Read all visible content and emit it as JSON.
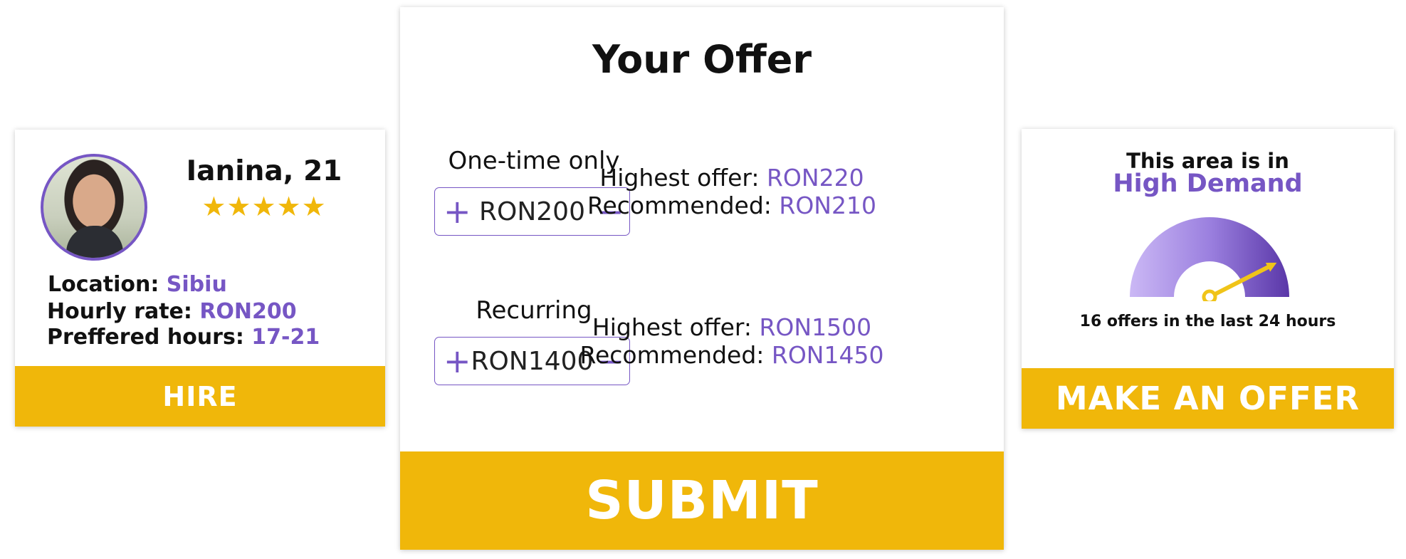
{
  "profile": {
    "name": "Ianina, 21",
    "stars": "★★★★★",
    "rating": 4.5,
    "location_label": "Location: ",
    "location_value": "Sibiu",
    "rate_label": "Hourly rate: ",
    "rate_value": "RON200",
    "hours_label": "Preffered hours: ",
    "hours_value": "17-21",
    "hire_label": "HIRE"
  },
  "offer": {
    "title": "Your Offer",
    "one_time": {
      "label": "One-time only",
      "value": "RON200",
      "highest_label": "Highest offer: ",
      "highest_value": "RON220",
      "recommended_label": "Recommended: ",
      "recommended_value": "RON210"
    },
    "recurring": {
      "label": "Recurring",
      "value": "RON1400",
      "highest_label": "Highest offer: ",
      "highest_value": "RON1500",
      "recommended_label": "Recommended: ",
      "recommended_value": "RON1450"
    },
    "plus_icon": "plus-icon",
    "minus_icon": "minus-icon",
    "submit_label": "SUBMIT"
  },
  "demand": {
    "line1": "This area is in",
    "line2": "High Demand",
    "gauge_level": 0.85,
    "count_text": "16 offers in the last 24 hours",
    "cta_label": "MAKE AN OFFER"
  },
  "colors": {
    "accent": "#7656c4",
    "button": "#f0b70a"
  }
}
